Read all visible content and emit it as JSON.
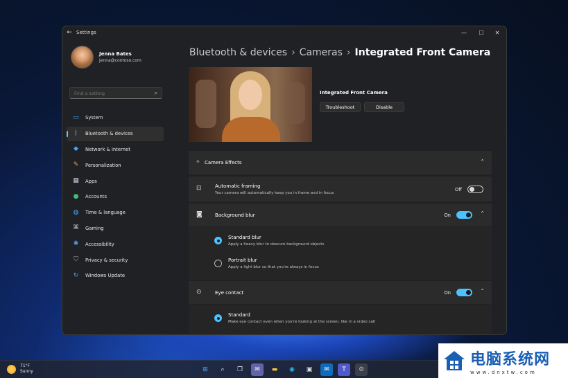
{
  "window": {
    "title": "Settings",
    "controls": {
      "minimize": "—",
      "maximize": "☐",
      "close": "✕"
    }
  },
  "profile": {
    "name": "Jenna Bates",
    "email": "jenna@contoso.com"
  },
  "search": {
    "placeholder": "Find a setting"
  },
  "sidebar": {
    "items": [
      {
        "label": "System",
        "icon": "system-icon"
      },
      {
        "label": "Bluetooth & devices",
        "icon": "bluetooth-icon",
        "active": true
      },
      {
        "label": "Network & internet",
        "icon": "wifi-icon"
      },
      {
        "label": "Personalization",
        "icon": "brush-icon"
      },
      {
        "label": "Apps",
        "icon": "apps-icon"
      },
      {
        "label": "Accounts",
        "icon": "accounts-icon"
      },
      {
        "label": "Time & language",
        "icon": "globe-icon"
      },
      {
        "label": "Gaming",
        "icon": "gamepad-icon"
      },
      {
        "label": "Accessibility",
        "icon": "accessibility-icon"
      },
      {
        "label": "Privacy & security",
        "icon": "shield-icon"
      },
      {
        "label": "Windows Update",
        "icon": "update-icon"
      }
    ]
  },
  "breadcrumb": {
    "part1": "Bluetooth & devices",
    "part2": "Cameras",
    "current": "Integrated Front Camera",
    "separator": "›"
  },
  "camera": {
    "name": "Integrated Front Camera",
    "troubleshoot": "Troubleshoot",
    "disable": "Disable"
  },
  "effects": {
    "header": "Camera Effects",
    "auto_framing": {
      "title": "Automatic framing",
      "desc": "Your camera will automatically keep you in frame and in focus",
      "state": "Off"
    },
    "background_blur": {
      "title": "Background blur",
      "state": "On",
      "standard": {
        "title": "Standard blur",
        "desc": "Apply a heavy blur to obscure background objects"
      },
      "portrait": {
        "title": "Portrait blur",
        "desc": "Apply a light blur so that you're always in focus"
      }
    },
    "eye_contact": {
      "title": "Eye contact",
      "state": "On",
      "standard": {
        "title": "Standard",
        "desc": "Make eye contact even when you're looking at the screen, like in a video call"
      }
    }
  },
  "taskbar": {
    "weather": {
      "temp": "71°F",
      "condition": "Sunny"
    },
    "apps": [
      "start-icon",
      "search-icon",
      "task-view-icon",
      "teams-chat-icon",
      "file-explorer-icon",
      "edge-icon",
      "store-icon",
      "outlook-icon",
      "teams-icon",
      "settings-icon"
    ]
  },
  "watermark": {
    "text": "电脑系统网",
    "url": "www.dnxtw.com"
  },
  "colors": {
    "accent": "#4cc2ff",
    "window_bg": "#202124",
    "panel_bg": "#2b2b2b"
  }
}
